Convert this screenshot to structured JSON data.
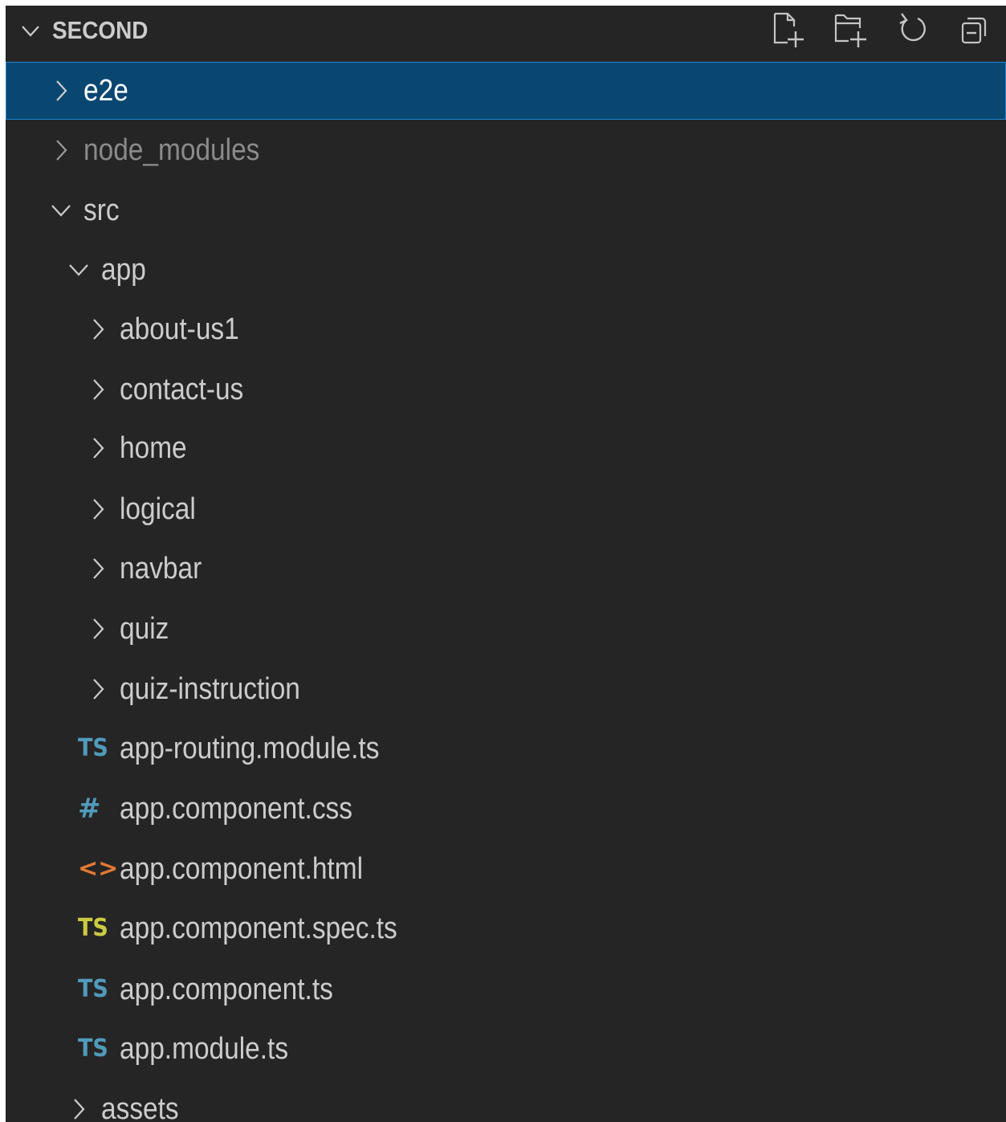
{
  "explorer": {
    "section_title": "SECOND",
    "actions": [
      {
        "name": "new-file-button",
        "icon": "new-file-icon"
      },
      {
        "name": "new-folder-button",
        "icon": "new-folder-icon"
      },
      {
        "name": "refresh-button",
        "icon": "refresh-icon"
      },
      {
        "name": "collapse-all-button",
        "icon": "collapse-all-icon"
      }
    ],
    "items": [
      {
        "label": "e2e",
        "type": "folder",
        "expanded": false,
        "depth": 0,
        "selected": true
      },
      {
        "label": "node_modules",
        "type": "folder",
        "expanded": false,
        "depth": 0,
        "dimmed": true
      },
      {
        "label": "src",
        "type": "folder",
        "expanded": true,
        "depth": 0
      },
      {
        "label": "app",
        "type": "folder",
        "expanded": true,
        "depth": 1
      },
      {
        "label": "about-us1",
        "type": "folder",
        "expanded": false,
        "depth": 2
      },
      {
        "label": "contact-us",
        "type": "folder",
        "expanded": false,
        "depth": 2
      },
      {
        "label": "home",
        "type": "folder",
        "expanded": false,
        "depth": 2
      },
      {
        "label": "logical",
        "type": "folder",
        "expanded": false,
        "depth": 2
      },
      {
        "label": "navbar",
        "type": "folder",
        "expanded": false,
        "depth": 2
      },
      {
        "label": "quiz",
        "type": "folder",
        "expanded": false,
        "depth": 2
      },
      {
        "label": "quiz-instruction",
        "type": "folder",
        "expanded": false,
        "depth": 2
      },
      {
        "label": "app-routing.module.ts",
        "type": "file",
        "icon": "ts",
        "icon_text": "TS",
        "depth": 2
      },
      {
        "label": "app.component.css",
        "type": "file",
        "icon": "css",
        "icon_text": "#",
        "depth": 2
      },
      {
        "label": "app.component.html",
        "type": "file",
        "icon": "html",
        "icon_text": "<>",
        "depth": 2
      },
      {
        "label": "app.component.spec.ts",
        "type": "file",
        "icon": "ts-spec",
        "icon_text": "TS",
        "depth": 2
      },
      {
        "label": "app.component.ts",
        "type": "file",
        "icon": "ts",
        "icon_text": "TS",
        "depth": 2
      },
      {
        "label": "app.module.ts",
        "type": "file",
        "icon": "ts",
        "icon_text": "TS",
        "depth": 2
      },
      {
        "label": "assets",
        "type": "folder",
        "expanded": false,
        "depth": 1
      }
    ]
  },
  "colors": {
    "panel_bg": "#252526",
    "selected_bg": "#094771",
    "selected_border": "#1e86d6",
    "text": "#cccccc",
    "dim_text": "#8b8b8b",
    "ts_icon": "#519aba",
    "ts_spec_icon": "#cbcb41",
    "css_icon": "#519aba",
    "html_icon": "#e37933"
  }
}
